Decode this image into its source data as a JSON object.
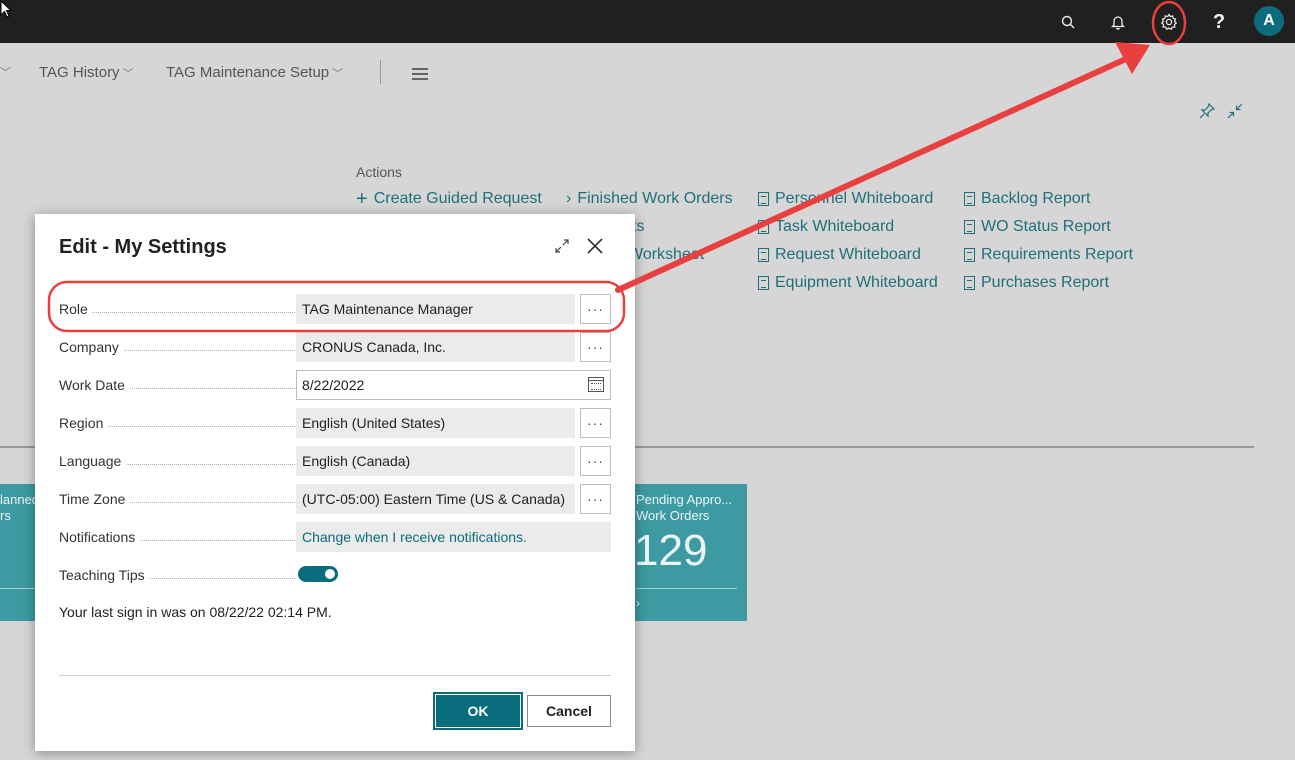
{
  "topbar": {
    "icons": [
      "search-icon",
      "bell-icon",
      "gear-icon",
      "help-icon"
    ],
    "help_label": "?",
    "avatar_initial": "A"
  },
  "nav": {
    "items": [
      "TAG History",
      "TAG Maintenance Setup"
    ]
  },
  "actions": {
    "title": "Actions",
    "col1": [
      "Create Guided Request"
    ],
    "col2": [
      "Finished Work Orders",
      "ts",
      "Worksheet"
    ],
    "col3": [
      "Personnel Whiteboard",
      "Task Whiteboard",
      "Request Whiteboard",
      "Equipment Whiteboard"
    ],
    "col4": [
      "Backlog Report",
      "WO Status Report",
      "Requirements Report",
      "Purchases Report"
    ]
  },
  "tiles": [
    {
      "label_line1": "lanned",
      "label_line2": "rs"
    },
    {
      "label_line1": "Pending Appro...",
      "label_line2": "Work Orders",
      "value": "129"
    }
  ],
  "dialog": {
    "title": "Edit - My Settings",
    "fields": {
      "role": {
        "label": "Role",
        "value": "TAG Maintenance Manager"
      },
      "company": {
        "label": "Company",
        "value": "CRONUS Canada, Inc."
      },
      "work_date": {
        "label": "Work Date",
        "value": "8/22/2022"
      },
      "region": {
        "label": "Region",
        "value": "English (United States)"
      },
      "language": {
        "label": "Language",
        "value": "English (Canada)"
      },
      "time_zone": {
        "label": "Time Zone",
        "value": "(UTC-05:00) Eastern Time (US & Canada)"
      },
      "notifications": {
        "label": "Notifications",
        "value": "Change when I receive notifications."
      },
      "teaching_tips": {
        "label": "Teaching Tips",
        "on": true
      }
    },
    "ellipsis": "···",
    "signin_text": "Your last sign in was on 08/22/22 02:14 PM.",
    "ok_label": "OK",
    "cancel_label": "Cancel"
  },
  "annotation": {
    "color": "#e8403f"
  }
}
